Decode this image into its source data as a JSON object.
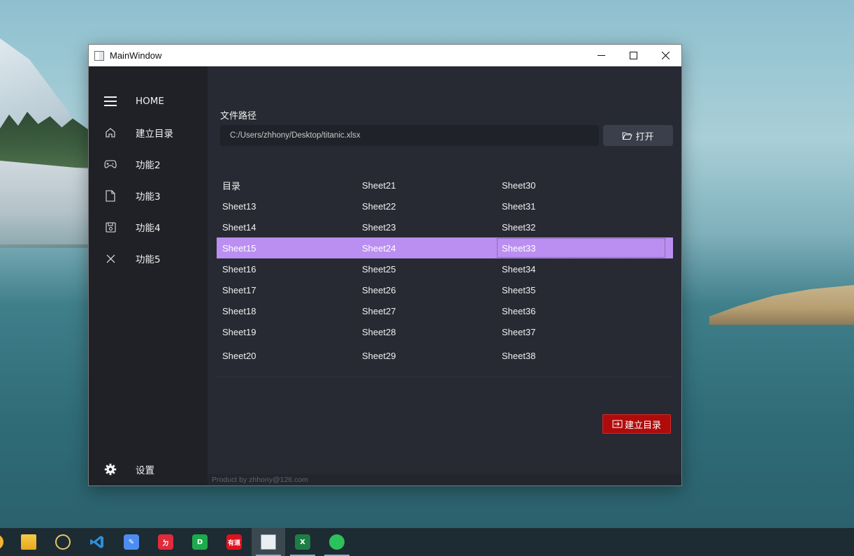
{
  "window": {
    "title": "MainWindow"
  },
  "sidebar": {
    "items": [
      {
        "label": "HOME",
        "icon": "menu-icon"
      },
      {
        "label": "建立目录",
        "icon": "home-icon"
      },
      {
        "label": "功能2",
        "icon": "gamepad-icon"
      },
      {
        "label": "功能3",
        "icon": "file-icon"
      },
      {
        "label": "功能4",
        "icon": "save-icon"
      },
      {
        "label": "功能5",
        "icon": "close-icon"
      }
    ],
    "settings_label": "设置"
  },
  "main": {
    "path_label": "文件路径",
    "path_value": "C:/Users/zhhony/Desktop/titanic.xlsx",
    "open_button_label": "打开",
    "table": {
      "rows": [
        [
          "目录",
          "Sheet21",
          "Sheet30"
        ],
        [
          "Sheet13",
          "Sheet22",
          "Sheet31"
        ],
        [
          "Sheet14",
          "Sheet23",
          "Sheet32"
        ],
        [
          "Sheet15",
          "Sheet24",
          "Sheet33"
        ],
        [
          "Sheet16",
          "Sheet25",
          "Sheet34"
        ],
        [
          "Sheet17",
          "Sheet26",
          "Sheet35"
        ],
        [
          "Sheet18",
          "Sheet27",
          "Sheet36"
        ],
        [
          "Sheet19",
          "Sheet28",
          "Sheet37"
        ],
        [
          "Sheet20",
          "Sheet29",
          "Sheet38"
        ]
      ],
      "selected_row": 3
    },
    "build_button_label": "建立目录",
    "footer_text": "Product by zhhony@126.com"
  },
  "taskbar": {
    "apps": [
      {
        "name": "file-explorer-icon"
      },
      {
        "name": "navicat-icon"
      },
      {
        "name": "vscode-icon"
      },
      {
        "name": "notes-app-icon"
      },
      {
        "name": "tool-app-icon"
      },
      {
        "name": "d-app-icon"
      },
      {
        "name": "dictionary-app-icon",
        "label": "有道"
      },
      {
        "name": "mainwindow-app-icon"
      },
      {
        "name": "excel-icon",
        "label": "X"
      },
      {
        "name": "wechat-icon"
      }
    ]
  },
  "colors": {
    "sidebar_bg": "#1f2127",
    "main_bg": "#272a33",
    "selected_row": "#bb8ff2",
    "build_button": "#b00b0b",
    "open_button": "#3a3f4b"
  }
}
